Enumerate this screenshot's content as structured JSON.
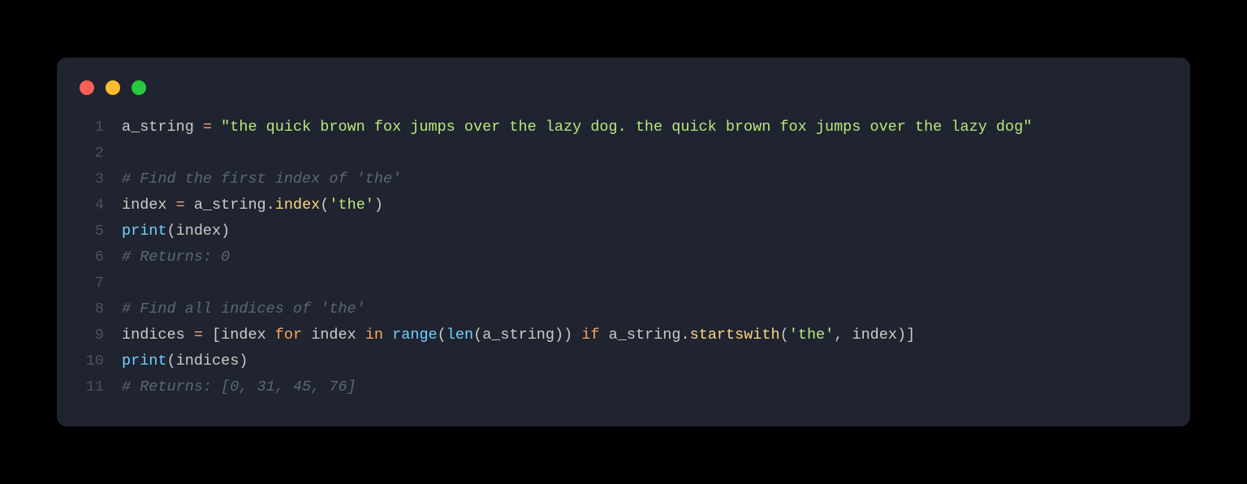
{
  "window": {
    "traffic_lights": [
      "red",
      "yellow",
      "green"
    ]
  },
  "code": {
    "lines": [
      {
        "num": "1",
        "tokens": [
          {
            "t": "plain",
            "v": "a_string "
          },
          {
            "t": "op",
            "v": "="
          },
          {
            "t": "plain",
            "v": " "
          },
          {
            "t": "string",
            "v": "\"the quick brown fox jumps over the lazy dog. the quick brown fox jumps over the lazy dog\""
          }
        ]
      },
      {
        "num": "2",
        "tokens": []
      },
      {
        "num": "3",
        "tokens": [
          {
            "t": "comment",
            "v": "# Find the first index of 'the'"
          }
        ]
      },
      {
        "num": "4",
        "tokens": [
          {
            "t": "plain",
            "v": "index "
          },
          {
            "t": "op",
            "v": "="
          },
          {
            "t": "plain",
            "v": " a_string"
          },
          {
            "t": "punct",
            "v": "."
          },
          {
            "t": "func",
            "v": "index"
          },
          {
            "t": "punct",
            "v": "("
          },
          {
            "t": "string",
            "v": "'the'"
          },
          {
            "t": "punct",
            "v": ")"
          }
        ]
      },
      {
        "num": "5",
        "tokens": [
          {
            "t": "builtin",
            "v": "print"
          },
          {
            "t": "punct",
            "v": "("
          },
          {
            "t": "plain",
            "v": "index"
          },
          {
            "t": "punct",
            "v": ")"
          }
        ]
      },
      {
        "num": "6",
        "tokens": [
          {
            "t": "comment",
            "v": "# Returns: 0"
          }
        ]
      },
      {
        "num": "7",
        "tokens": []
      },
      {
        "num": "8",
        "tokens": [
          {
            "t": "comment",
            "v": "# Find all indices of 'the'"
          }
        ]
      },
      {
        "num": "9",
        "tokens": [
          {
            "t": "plain",
            "v": "indices "
          },
          {
            "t": "op",
            "v": "="
          },
          {
            "t": "plain",
            "v": " "
          },
          {
            "t": "punct",
            "v": "["
          },
          {
            "t": "plain",
            "v": "index "
          },
          {
            "t": "keyword",
            "v": "for"
          },
          {
            "t": "plain",
            "v": " index "
          },
          {
            "t": "keyword",
            "v": "in"
          },
          {
            "t": "plain",
            "v": " "
          },
          {
            "t": "builtin",
            "v": "range"
          },
          {
            "t": "punct",
            "v": "("
          },
          {
            "t": "builtin",
            "v": "len"
          },
          {
            "t": "punct",
            "v": "("
          },
          {
            "t": "plain",
            "v": "a_string"
          },
          {
            "t": "punct",
            "v": "))"
          },
          {
            "t": "plain",
            "v": " "
          },
          {
            "t": "keyword",
            "v": "if"
          },
          {
            "t": "plain",
            "v": " a_string"
          },
          {
            "t": "punct",
            "v": "."
          },
          {
            "t": "func",
            "v": "startswith"
          },
          {
            "t": "punct",
            "v": "("
          },
          {
            "t": "string",
            "v": "'the'"
          },
          {
            "t": "punct",
            "v": ","
          },
          {
            "t": "plain",
            "v": " index"
          },
          {
            "t": "punct",
            "v": ")]"
          }
        ]
      },
      {
        "num": "10",
        "tokens": [
          {
            "t": "builtin",
            "v": "print"
          },
          {
            "t": "punct",
            "v": "("
          },
          {
            "t": "plain",
            "v": "indices"
          },
          {
            "t": "punct",
            "v": ")"
          }
        ]
      },
      {
        "num": "11",
        "tokens": [
          {
            "t": "comment",
            "v": "# Returns: [0, 31, 45, 76]"
          }
        ]
      }
    ]
  }
}
